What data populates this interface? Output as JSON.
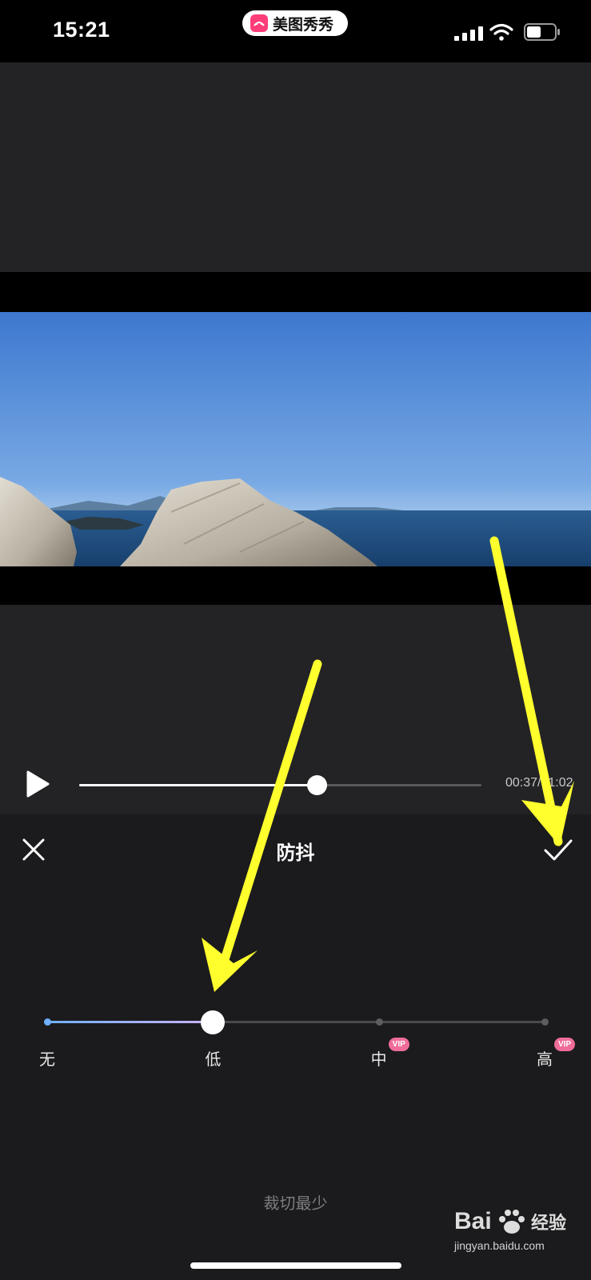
{
  "status_bar": {
    "time": "15:21",
    "app_name": "美图秀秀"
  },
  "player": {
    "time_display": "00:37/01:02",
    "progress_fraction": 0.59
  },
  "panel": {
    "title": "防抖",
    "levels": [
      {
        "label": "无",
        "vip": false
      },
      {
        "label": "低",
        "vip": false
      },
      {
        "label": "中",
        "vip": true
      },
      {
        "label": "高",
        "vip": true
      }
    ],
    "vip_label": "VIP",
    "selected_index": 1,
    "hint": "裁切最少"
  },
  "watermark": {
    "brand": "Bai",
    "suffix": "经验",
    "url": "jingyan.baidu.com"
  },
  "colors": {
    "accent_start": "#6fb0ff",
    "accent_end": "#cbb2ff",
    "vip": "#f06d99",
    "annotation": "#ffff2e"
  }
}
